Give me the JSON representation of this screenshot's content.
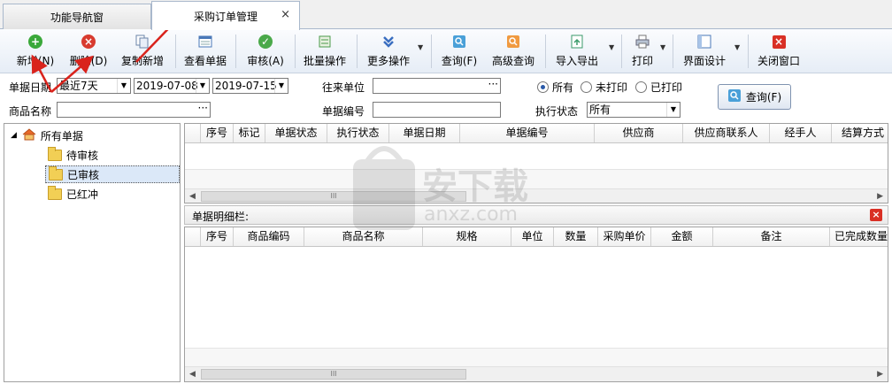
{
  "tabs": [
    {
      "label": "功能导航窗"
    },
    {
      "label": "采购订单管理",
      "close": "×"
    }
  ],
  "toolbar": {
    "new": "新增(N)",
    "delete": "删除(D)",
    "copy_new": "复制新增",
    "view": "查看单据",
    "audit": "审核(A)",
    "batch": "批量操作",
    "more": "更多操作",
    "query": "查询(F)",
    "adv_query": "高级查询",
    "import_export": "导入导出",
    "print": "打印",
    "ui_design": "界面设计",
    "close_window": "关闭窗口"
  },
  "filters": {
    "date_label": "单据日期",
    "date_range": "最近7天",
    "date_from": "2019-07-08",
    "date_to": "2019-07-15",
    "partner_label": "往来单位",
    "partner_value": "",
    "product_label": "商品名称",
    "product_value": "",
    "docno_label": "单据编号",
    "docno_value": "",
    "print_all": "所有",
    "print_unprinted": "未打印",
    "print_printed": "已打印",
    "exec_label": "执行状态",
    "exec_value": "所有",
    "query_button": "查询(F)",
    "dots": "···"
  },
  "tree": {
    "root": "所有单据",
    "items": [
      "待审核",
      "已审核",
      "已红冲"
    ],
    "selected": "已审核"
  },
  "main_grid": {
    "columns": [
      "序号",
      "标记",
      "单据状态",
      "执行状态",
      "单据日期",
      "单据编号",
      "供应商",
      "供应商联系人",
      "经手人",
      "结算方式"
    ]
  },
  "detail": {
    "title": "单据明细栏:",
    "close": "×",
    "columns": [
      "序号",
      "商品编码",
      "商品名称",
      "规格",
      "单位",
      "数量",
      "采购单价",
      "金额",
      "备注",
      "已完成数量"
    ]
  },
  "scroll_thumb": "III",
  "watermark_text": "安下载",
  "watermark_sub": "anxz.com",
  "colors": {
    "accent_red": "#d9231c",
    "add_green": "#3aa83a",
    "delete_red": "#d83b2f",
    "selection": "#dbe8f8"
  }
}
